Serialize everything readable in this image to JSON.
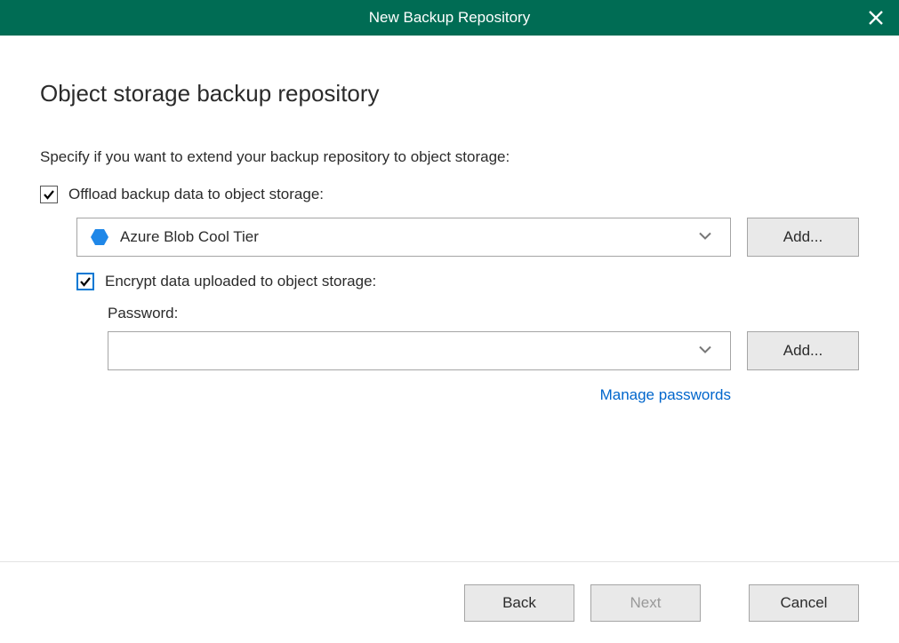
{
  "titlebar": {
    "title": "New Backup Repository"
  },
  "main": {
    "heading": "Object storage backup repository",
    "description": "Specify if you want to extend your backup repository to object storage:",
    "offload_checkbox_label": "Offload backup data to object storage:",
    "storage_dropdown_value": "Azure Blob Cool Tier",
    "add_storage_button": "Add...",
    "encrypt_checkbox_label": "Encrypt data uploaded to object storage:",
    "password_label": "Password:",
    "password_dropdown_value": "",
    "add_password_button": "Add...",
    "manage_passwords_link": "Manage passwords"
  },
  "footer": {
    "back_button": "Back",
    "next_button": "Next",
    "cancel_button": "Cancel"
  }
}
